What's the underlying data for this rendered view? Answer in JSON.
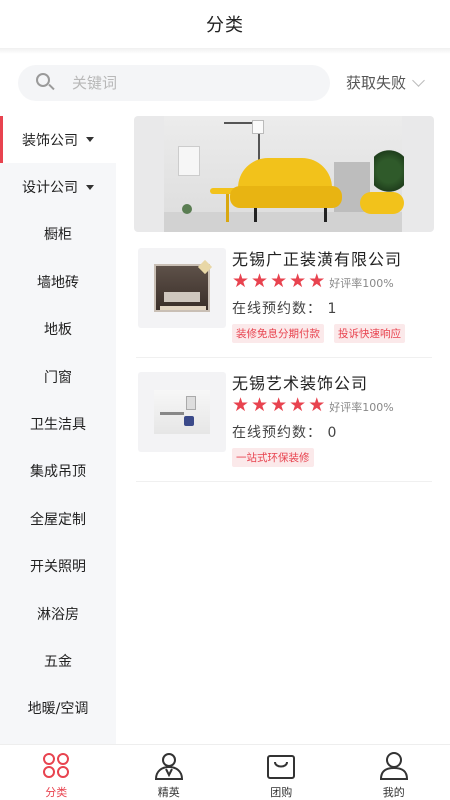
{
  "header": {
    "title": "分类"
  },
  "search": {
    "placeholder": "关键词",
    "location_label": "获取失败"
  },
  "sidebar": {
    "items": [
      {
        "label": "装饰公司",
        "has_dropdown": true,
        "active": true
      },
      {
        "label": "设计公司",
        "has_dropdown": true,
        "active": false
      },
      {
        "label": "橱柜"
      },
      {
        "label": "墙地砖"
      },
      {
        "label": "地板"
      },
      {
        "label": "门窗"
      },
      {
        "label": "卫生洁具"
      },
      {
        "label": "集成吊顶"
      },
      {
        "label": "全屋定制"
      },
      {
        "label": "开关照明"
      },
      {
        "label": "淋浴房"
      },
      {
        "label": "五金"
      },
      {
        "label": "地暖/空调"
      }
    ]
  },
  "companies": [
    {
      "name": "无锡广正装潢有限公司",
      "stars": 5,
      "rating_text": "好评率100%",
      "appointments_text": "在线预约数：  1",
      "tags": [
        "装修免息分期付款",
        "投诉快速响应"
      ]
    },
    {
      "name": "无锡艺术装饰公司",
      "stars": 5,
      "rating_text": "好评率100%",
      "appointments_text": "在线预约数：  0",
      "tags": [
        "一站式环保装修"
      ]
    }
  ],
  "tabbar": {
    "tabs": [
      {
        "label": "分类",
        "icon": "category-icon",
        "active": true
      },
      {
        "label": "精英",
        "icon": "elite-person-icon",
        "active": false
      },
      {
        "label": "团购",
        "icon": "group-buy-bag-icon",
        "active": false
      },
      {
        "label": "我的",
        "icon": "profile-icon",
        "active": false
      }
    ]
  },
  "colors": {
    "accent": "#e8434f",
    "sidebar_bg": "#f6f7f9",
    "search_bg": "#f4f5f7"
  }
}
